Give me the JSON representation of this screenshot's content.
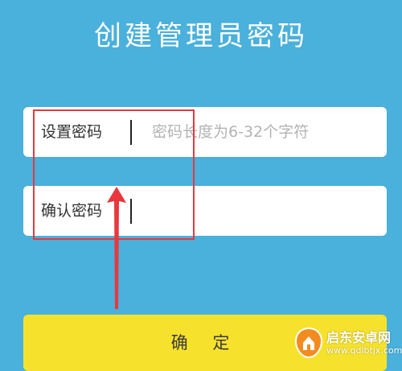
{
  "page": {
    "title": "创建管理员密码"
  },
  "form": {
    "password_label": "设置密码",
    "password_placeholder": "密码长度为6-32个字符",
    "password_value": "",
    "confirm_label": "确认密码",
    "confirm_placeholder": "",
    "confirm_value": ""
  },
  "confirm_button": {
    "label": "确 定"
  },
  "annotation": {
    "box_color": "#e8383d",
    "arrow_color": "#e8383d"
  },
  "watermark": {
    "name": "启东安卓网",
    "url": "www.qdlbtjx.com"
  },
  "colors": {
    "background": "#4ab0dc",
    "button": "#f6e22c",
    "field": "#ffffff"
  }
}
